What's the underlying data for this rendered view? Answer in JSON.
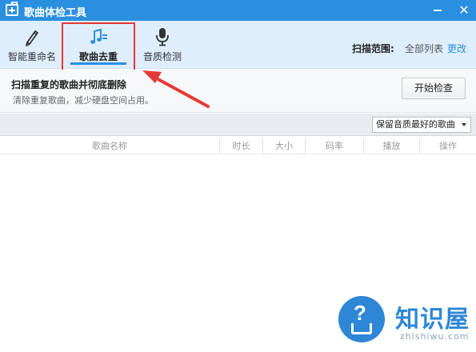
{
  "window": {
    "title": "歌曲体检工具",
    "accent_color": "#2b8fe0",
    "icons": {
      "app": "medical-kit-icon",
      "minimize": "minimize-icon",
      "close": "close-icon"
    }
  },
  "tabs": [
    {
      "label": "智能重命名",
      "icon": "pencil-icon",
      "selected": false
    },
    {
      "label": "歌曲去重",
      "icon": "music-note-icon",
      "selected": true
    },
    {
      "label": "音质检测",
      "icon": "microphone-icon",
      "selected": false
    }
  ],
  "scan_range": {
    "label": "扫描范围:",
    "value": "全部列表",
    "change_link": "更改"
  },
  "info": {
    "title": "扫描重复的歌曲并彻底删除",
    "description": "清除重复歌曲，减少硬盘空间占用。",
    "start_button": "开始检查"
  },
  "filter": {
    "selected": "保留音质最好的歌曲"
  },
  "table": {
    "columns": [
      "歌曲名称",
      "时长",
      "大小",
      "码率",
      "播放",
      "操作"
    ],
    "rows": []
  },
  "watermark": {
    "brand": "知识屋",
    "url": "zhishiwu.com"
  },
  "annotation": {
    "highlight_color": "#e53935"
  }
}
